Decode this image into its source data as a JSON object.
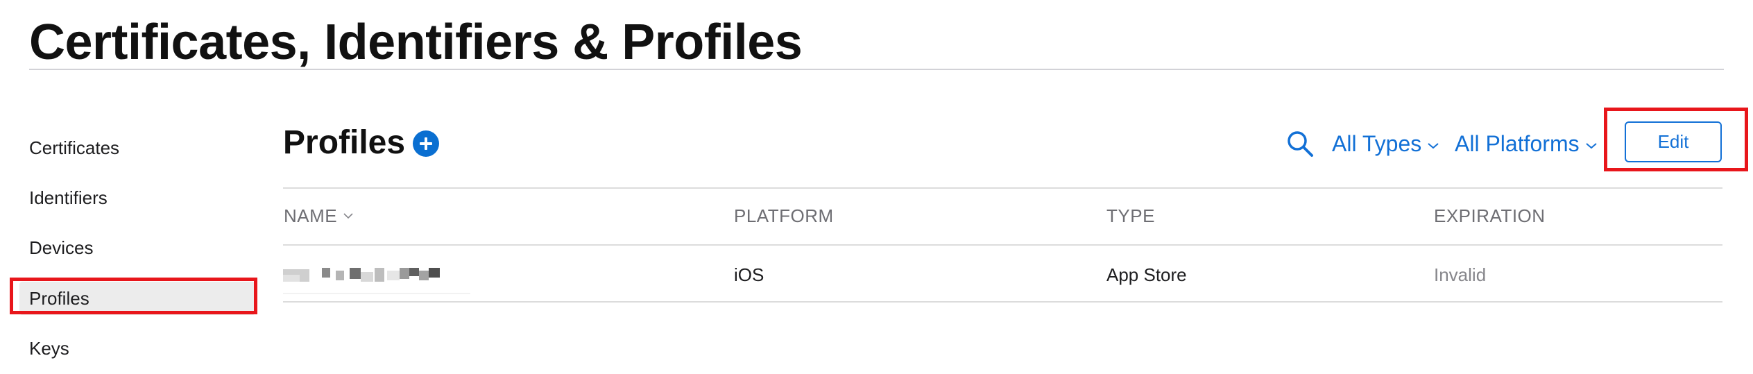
{
  "header": {
    "title": "Certificates, Identifiers & Profiles"
  },
  "sidebar": {
    "items": [
      {
        "label": "Certificates",
        "active": false
      },
      {
        "label": "Identifiers",
        "active": false
      },
      {
        "label": "Devices",
        "active": false
      },
      {
        "label": "Profiles",
        "active": true
      },
      {
        "label": "Keys",
        "active": false
      }
    ]
  },
  "main": {
    "title": "Profiles",
    "add_icon": "plus-circle-icon",
    "search_icon": "search-icon",
    "filters": {
      "types": "All Types",
      "platforms": "All Platforms"
    },
    "edit_label": "Edit",
    "table": {
      "columns": [
        "NAME",
        "PLATFORM",
        "TYPE",
        "EXPIRATION"
      ],
      "rows": [
        {
          "name": "",
          "platform": "iOS",
          "type": "App Store",
          "expiration": "Invalid"
        }
      ]
    }
  },
  "colors": {
    "accent": "#1270d6",
    "highlight": "#e8161b",
    "add_icon": "#0a6fd1"
  }
}
